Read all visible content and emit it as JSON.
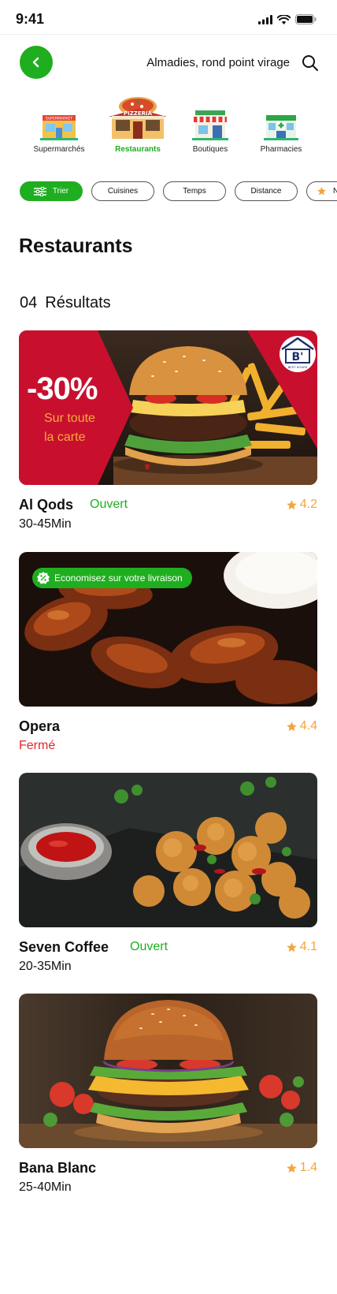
{
  "status_bar": {
    "time": "9:41"
  },
  "header": {
    "location": "Almadies, rond point virage"
  },
  "categories": [
    {
      "label": "Supermarchés",
      "sign": "SUPERMARKET"
    },
    {
      "label": "Restaurants",
      "sign": "PIZZERIA"
    },
    {
      "label": "Boutiques"
    },
    {
      "label": "Pharmacies"
    }
  ],
  "filters": [
    {
      "label": "Trier"
    },
    {
      "label": "Cuisines"
    },
    {
      "label": "Temps"
    },
    {
      "label": "Distance"
    },
    {
      "label": "N"
    }
  ],
  "section_title": "Restaurants",
  "results": {
    "count": "04",
    "label": "Résultats"
  },
  "restaurants": [
    {
      "name": "Al Qods",
      "status": "Ouvert",
      "time": "30-45Min",
      "rating": "4.2",
      "promo": {
        "discount": "-30%",
        "line1": "Sur toute",
        "line2": "la carte"
      },
      "logo": "B'",
      "logo_caption": "BEST HOURS"
    },
    {
      "name": "Opera",
      "status": "Fermé",
      "rating": "4.4",
      "badge": "Economisez sur votre livraison"
    },
    {
      "name": "Seven Coffee",
      "status": "Ouvert",
      "time": "20-35Min",
      "rating": "4.1"
    },
    {
      "name": "Bana Blanc",
      "time": "25-40Min",
      "rating": "1.4"
    }
  ],
  "colors": {
    "accent": "#1fae1f",
    "closed": "#e0262d",
    "rating": "#f4a53c",
    "promo": "#c8102e"
  },
  "icons": {
    "back": "chevron-left-icon",
    "search": "search-icon",
    "sort": "sliders-icon",
    "star": "star-icon"
  }
}
